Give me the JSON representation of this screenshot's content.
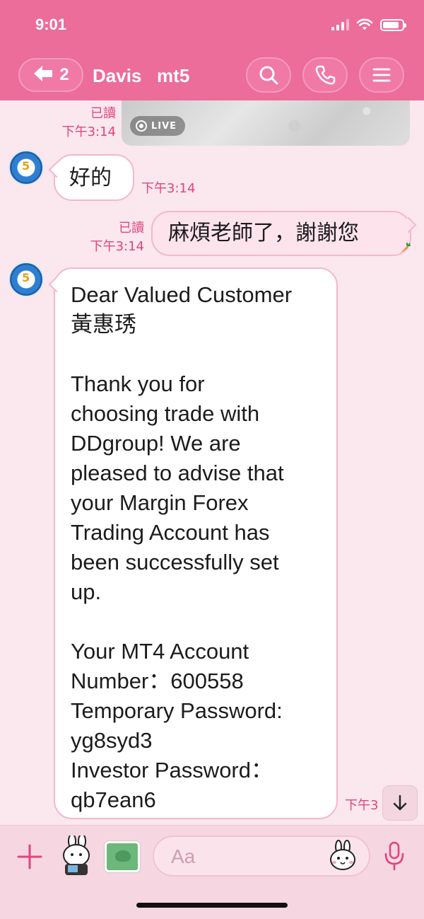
{
  "status_bar": {
    "time": "9:01"
  },
  "header": {
    "back_count": "2",
    "title": "Davis   mt5"
  },
  "messages": {
    "live_media": {
      "read_label": "已讀",
      "time": "下午3:14",
      "badge": "LIVE"
    },
    "incoming_1": {
      "text": "好的",
      "time": "下午3:14"
    },
    "outgoing_1": {
      "text": "麻煩老師了，謝謝您",
      "read_label": "已讀",
      "time": "下午3:14"
    },
    "incoming_2": {
      "text": "Dear Valued Customer\n黃惠琇\n\nThank you for\nchoosing trade with\nDDgroup! We are\npleased to advise that\nyour Margin Forex\nTrading Account has\nbeen successfully set\nup.\n\nYour MT4 Account\nNumber：600558\nTemporary Password:\nyg8syd3\nInvestor Password：\nqb7ean6",
      "time": "下午3"
    }
  },
  "composer": {
    "placeholder": "Aa"
  },
  "colors": {
    "accent": "#ec6c9a",
    "timestamp": "#e0457d",
    "background": "#fbe7ee"
  }
}
